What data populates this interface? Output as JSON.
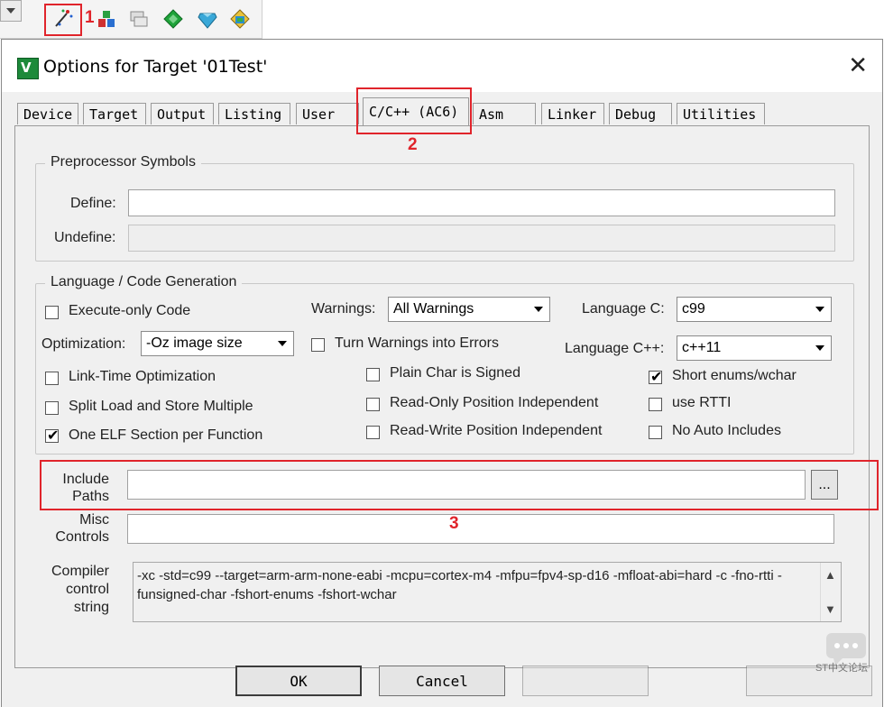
{
  "toolbar": {
    "annotation_1": "1"
  },
  "dialog": {
    "title": "Options for Target '01Test'",
    "icon_letter": "V",
    "close_glyph": "✕"
  },
  "tabs": [
    {
      "label": "Device"
    },
    {
      "label": "Target"
    },
    {
      "label": "Output"
    },
    {
      "label": "Listing"
    },
    {
      "label": "User"
    },
    {
      "label": "C/C++ (AC6)"
    },
    {
      "label": "Asm"
    },
    {
      "label": "Linker"
    },
    {
      "label": "Debug"
    },
    {
      "label": "Utilities"
    }
  ],
  "annotation_2": "2",
  "annotation_3": "3",
  "preprocessor": {
    "title": "Preprocessor Symbols",
    "define_label": "Define:",
    "define_value": "",
    "undefine_label": "Undefine:",
    "undefine_value": ""
  },
  "language": {
    "title": "Language / Code Generation",
    "execute_only": {
      "label": "Execute-only Code",
      "checked": false
    },
    "warnings_label": "Warnings:",
    "warnings_value": "All Warnings",
    "language_c_label": "Language C:",
    "language_c_value": "c99",
    "optimization_label": "Optimization:",
    "optimization_value": "-Oz image size",
    "turn_warnings": {
      "label": "Turn Warnings into Errors",
      "checked": false
    },
    "language_cpp_label": "Language C++:",
    "language_cpp_value": "c++11",
    "link_time": {
      "label": "Link-Time Optimization",
      "checked": false
    },
    "plain_char": {
      "label": "Plain Char is Signed",
      "checked": false
    },
    "short_enums": {
      "label": "Short enums/wchar",
      "checked": true
    },
    "split_load": {
      "label": "Split Load and Store Multiple",
      "checked": false
    },
    "ro_pos": {
      "label": "Read-Only Position Independent",
      "checked": false
    },
    "use_rtti": {
      "label": "use RTTI",
      "checked": false
    },
    "one_elf": {
      "label": "One ELF Section per Function",
      "checked": true
    },
    "rw_pos": {
      "label": "Read-Write Position Independent",
      "checked": false
    },
    "no_auto": {
      "label": "No Auto Includes",
      "checked": false
    }
  },
  "include_paths": {
    "label_line1": "Include",
    "label_line2": "Paths",
    "value": "",
    "browse_label": "..."
  },
  "misc": {
    "label_line1": "Misc",
    "label_line2": "Controls",
    "value": ""
  },
  "compiler": {
    "label_line1": "Compiler",
    "label_line2": "control",
    "label_line3": "string",
    "value": "-xc -std=c99 --target=arm-arm-none-eabi -mcpu=cortex-m4 -mfpu=fpv4-sp-d16 -mfloat-abi=hard -c -fno-rtti -funsigned-char -fshort-enums -fshort-wchar"
  },
  "buttons": {
    "ok": "OK",
    "cancel": "Cancel"
  },
  "watermark": "ST中文论坛",
  "colors": {
    "annotation_red": "#e0242b",
    "dialog_bg": "#f0f0f0"
  }
}
